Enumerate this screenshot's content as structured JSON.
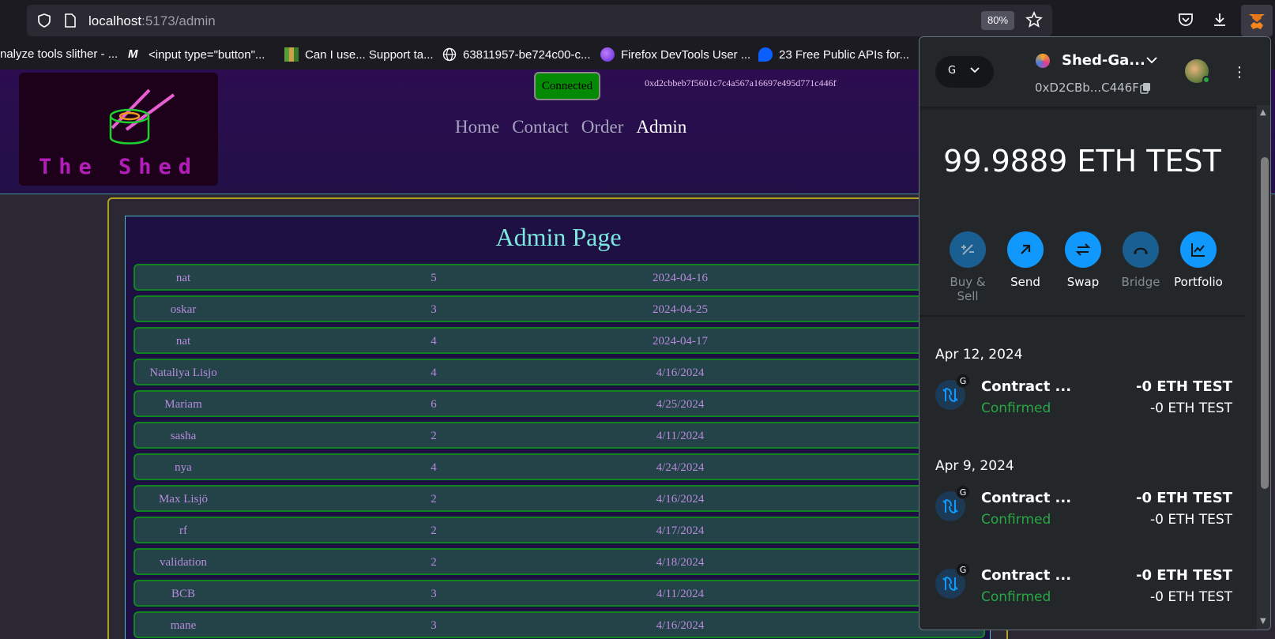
{
  "browser": {
    "url_host": "localhost",
    "url_path": ":5173/admin",
    "zoom": "80%",
    "bookmarks": [
      "nalyze tools slither - ...",
      "<input type=\"button\"...",
      "Can I use... Support ta...",
      "63811957-be724c00-c...",
      "Firefox DevTools User ...",
      "23 Free Public APIs for..."
    ]
  },
  "site": {
    "logo_text": "The Shed",
    "connected_label": "Connected",
    "wallet_address": "0xd2cbbeb7f5601c7c4a567a16697e495d771c446f",
    "nav": [
      "Home",
      "Contact",
      "Order",
      "Admin"
    ],
    "admin_title": "Admin Page",
    "rows": [
      {
        "name": "nat",
        "qty": "5",
        "date": "2024-04-16"
      },
      {
        "name": "oskar",
        "qty": "3",
        "date": "2024-04-25"
      },
      {
        "name": "nat",
        "qty": "4",
        "date": "2024-04-17"
      },
      {
        "name": "Nataliya Lisjo",
        "qty": "4",
        "date": "4/16/2024"
      },
      {
        "name": "Mariam",
        "qty": "6",
        "date": "4/25/2024"
      },
      {
        "name": "sasha",
        "qty": "2",
        "date": "4/11/2024"
      },
      {
        "name": "nya",
        "qty": "4",
        "date": "4/24/2024"
      },
      {
        "name": "Max Lisjö",
        "qty": "2",
        "date": "4/16/2024"
      },
      {
        "name": "rf",
        "qty": "2",
        "date": "4/17/2024"
      },
      {
        "name": "validation",
        "qty": "2",
        "date": "4/18/2024"
      },
      {
        "name": "BCB",
        "qty": "3",
        "date": "4/11/2024"
      },
      {
        "name": "mane",
        "qty": "3",
        "date": "4/16/2024"
      }
    ]
  },
  "metamask": {
    "network_letter": "G",
    "account_name": "Shed-Ga...",
    "account_address": "0xD2CBb...C446F",
    "balance": "99.9889 ETH TEST",
    "actions": [
      "Buy & Sell",
      "Send",
      "Swap",
      "Bridge",
      "Portfolio"
    ],
    "groups": [
      {
        "date": "Apr 12, 2024",
        "txs": [
          {
            "name": "Contract ...",
            "status": "Confirmed",
            "amount": "-0 ETH TEST",
            "amount2": "-0 ETH TEST"
          }
        ]
      },
      {
        "date": "Apr 9, 2024",
        "txs": [
          {
            "name": "Contract ...",
            "status": "Confirmed",
            "amount": "-0 ETH TEST",
            "amount2": "-0 ETH TEST"
          },
          {
            "name": "Contract ...",
            "status": "Confirmed",
            "amount": "-0 ETH TEST",
            "amount2": "-0 ETH TEST"
          }
        ]
      }
    ]
  },
  "colors": {
    "accent_blue": "#1098fc",
    "confirmed_green": "#28a745",
    "row_border": "#12851f",
    "title_teal": "#7de8e0"
  }
}
